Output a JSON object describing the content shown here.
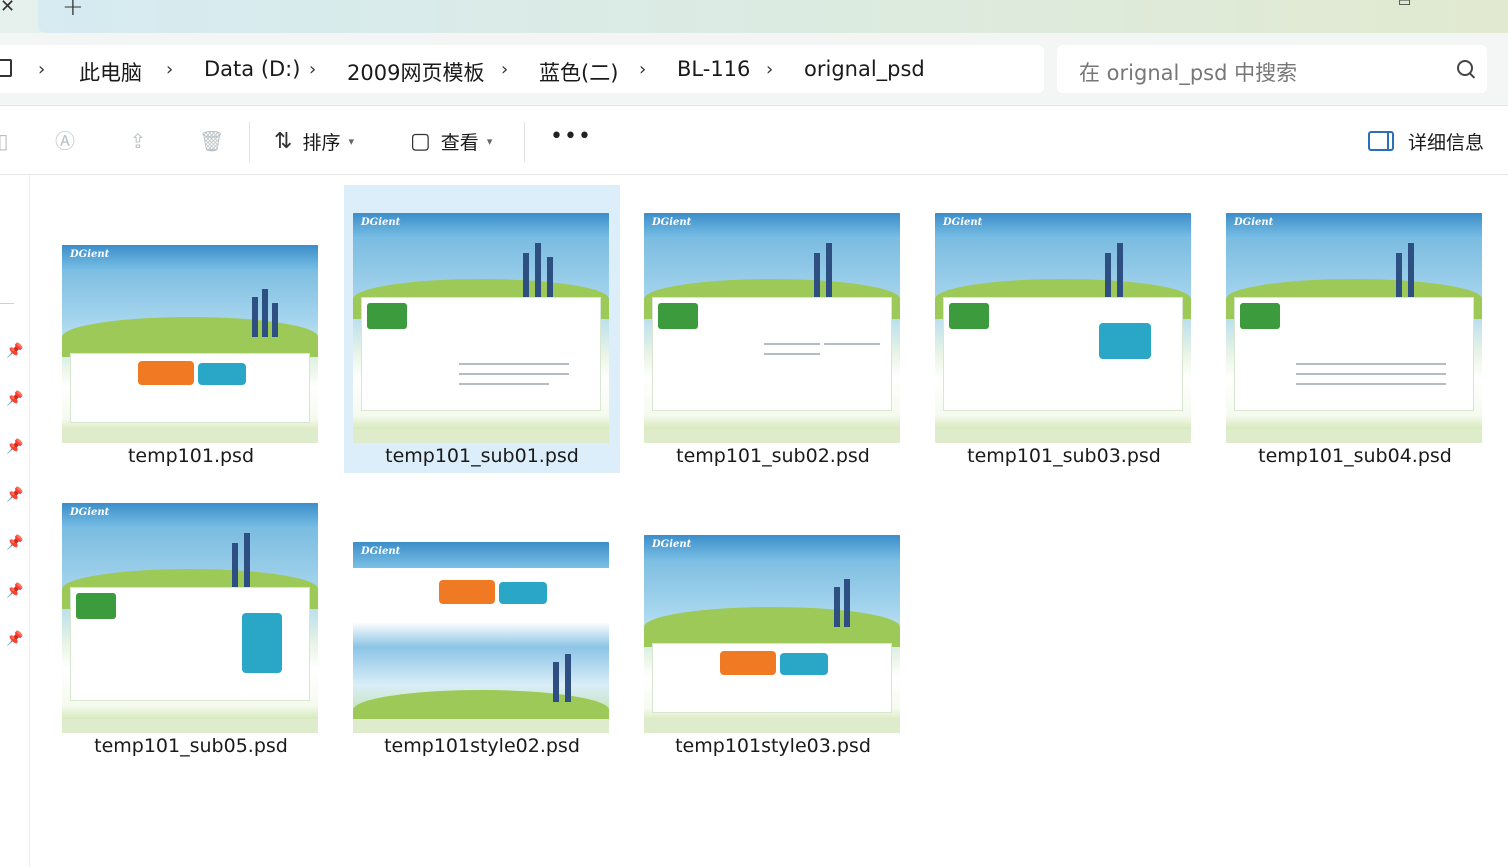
{
  "breadcrumb": {
    "items": [
      "此电脑",
      "Data (D:)",
      "2009网页模板",
      "蓝色(二)",
      "BL-116",
      "orignal_psd"
    ]
  },
  "search": {
    "placeholder": "在 orignal_psd 中搜索"
  },
  "toolbar": {
    "sort_label": "排序",
    "view_label": "查看",
    "more_label": "•••",
    "details_label": "详细信息"
  },
  "files": [
    {
      "name": "temp101.psd",
      "selected": false
    },
    {
      "name": "temp101_sub01.psd",
      "selected": true
    },
    {
      "name": "temp101_sub02.psd",
      "selected": false
    },
    {
      "name": "temp101_sub03.psd",
      "selected": false
    },
    {
      "name": "temp101_sub04.psd",
      "selected": false
    },
    {
      "name": "temp101_sub05.psd",
      "selected": false
    },
    {
      "name": "temp101style02.psd",
      "selected": false
    },
    {
      "name": "temp101style03.psd",
      "selected": false
    }
  ],
  "thumbnail_logo": "DGient",
  "colors": {
    "accent": "#2b6fb5",
    "selection": "#dbeefa"
  }
}
